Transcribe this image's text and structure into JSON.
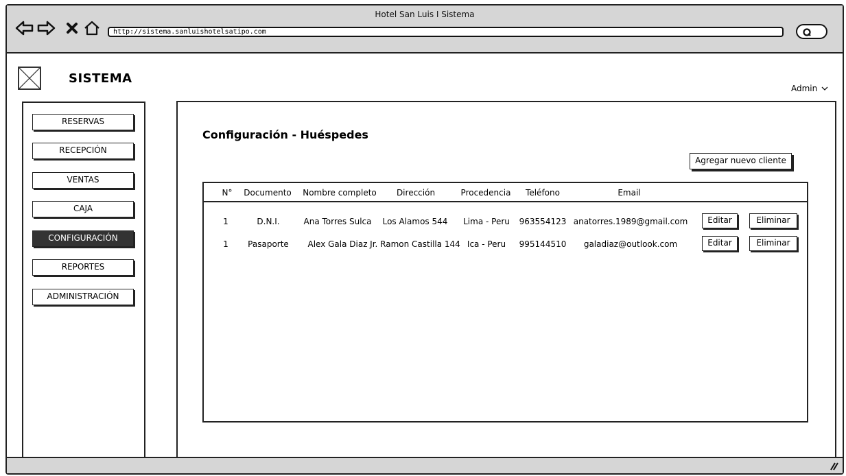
{
  "window": {
    "title": "Hotel San Luis I Sistema",
    "url": "http://sistema.sanluishotelsatipo.com"
  },
  "icons": {
    "back": "arrow-left-icon",
    "forward": "arrow-right-icon",
    "stop": "close-icon",
    "home": "home-icon",
    "search": "search-icon",
    "logo": "image-placeholder-icon",
    "user_menu": "chevron-down-icon",
    "resize": "resize-grip-icon"
  },
  "header": {
    "brand": "SISTEMA",
    "user": "Admin"
  },
  "sidebar": {
    "items": [
      {
        "label": "RESERVAS",
        "active": false
      },
      {
        "label": "RECEPCIÓN",
        "active": false
      },
      {
        "label": "VENTAS",
        "active": false
      },
      {
        "label": "CAJA",
        "active": false
      },
      {
        "label": "CONFIGURACIÓN",
        "active": true
      },
      {
        "label": "REPORTES",
        "active": false
      },
      {
        "label": "ADMINISTRACIÓN",
        "active": false
      }
    ]
  },
  "main": {
    "title": "Configuración - Huéspedes",
    "add_button": "Agregar nuevo cliente",
    "table": {
      "columns": [
        "N°",
        "Documento",
        "Nombre completo",
        "Dirección",
        "Procedencia",
        "Teléfono",
        "Email"
      ],
      "rows": [
        {
          "n": "1",
          "documento": "D.N.I.",
          "nombre": "Ana Torres Sulca",
          "direccion": "Los Alamos 544",
          "procedencia": "Lima - Peru",
          "telefono": "963554123",
          "email": "anatorres.1989@gmail.com",
          "edit": "Editar",
          "delete": "Eliminar"
        },
        {
          "n": "1",
          "documento": "Pasaporte",
          "nombre": "Alex Gala Diaz",
          "direccion": "Jr. Ramon Castilla 144",
          "procedencia": "Ica - Peru",
          "telefono": "995144510",
          "email": "galadiaz@outlook.com",
          "edit": "Editar",
          "delete": "Eliminar"
        }
      ]
    }
  }
}
